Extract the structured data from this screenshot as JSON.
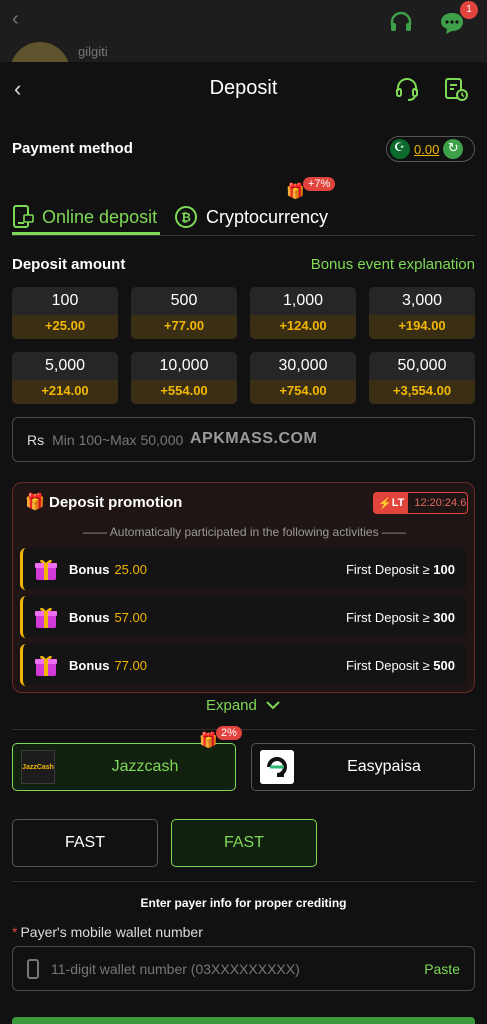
{
  "background_app": {
    "back_icon": "back-chevron-icon",
    "username": "gilgiti",
    "notification_count": "1"
  },
  "header": {
    "title": "Deposit",
    "support_icon": "headset-icon",
    "history_icon": "history-icon"
  },
  "payment_method": {
    "label": "Payment method",
    "balance": "0.00"
  },
  "tabs": [
    {
      "label": "Online deposit",
      "active": true
    },
    {
      "label": "Cryptocurrency",
      "active": false,
      "badge": "+7%"
    }
  ],
  "deposit_amount": {
    "label": "Deposit amount",
    "bonus_link": "Bonus event explanation",
    "options": [
      {
        "amount": "100",
        "bonus": "+25.00"
      },
      {
        "amount": "500",
        "bonus": "+77.00"
      },
      {
        "amount": "1,000",
        "bonus": "+124.00"
      },
      {
        "amount": "3,000",
        "bonus": "+194.00"
      },
      {
        "amount": "5,000",
        "bonus": "+214.00"
      },
      {
        "amount": "10,000",
        "bonus": "+554.00"
      },
      {
        "amount": "30,000",
        "bonus": "+754.00"
      },
      {
        "amount": "50,000",
        "bonus": "+3,554.00"
      }
    ],
    "currency": "Rs",
    "placeholder": "Min 100~Max 50,000",
    "watermark": "APKMASS.COM"
  },
  "promotion": {
    "title": "Deposit promotion",
    "timer_tag": "LT",
    "timer": "12:20:24.6",
    "subtitle": "—— Automatically participated in the following activities ——",
    "rows": [
      {
        "bonus_label": "Bonus",
        "bonus_value": "25.00",
        "condition": "First Deposit ≥",
        "threshold": "100"
      },
      {
        "bonus_label": "Bonus",
        "bonus_value": "57.00",
        "condition": "First Deposit ≥",
        "threshold": "300"
      },
      {
        "bonus_label": "Bonus",
        "bonus_value": "77.00",
        "condition": "First Deposit ≥",
        "threshold": "500"
      }
    ],
    "expand_label": "Expand"
  },
  "channels": [
    {
      "name": "Jazzcash",
      "logo_text": "JazzCash",
      "badge": "2%",
      "selected": true
    },
    {
      "name": "Easypaisa",
      "selected": false
    }
  ],
  "speed_options": [
    {
      "label": "FAST",
      "selected": false
    },
    {
      "label": "FAST",
      "selected": true
    }
  ],
  "payer": {
    "note": "Enter payer info for proper crediting",
    "required_mark": "*",
    "wallet_label": "Payer's mobile wallet number",
    "wallet_placeholder": "11-digit wallet number (03XXXXXXXXX)",
    "paste_label": "Paste"
  },
  "colors": {
    "accent_green": "#7ed957",
    "bonus_gold": "#f2b705",
    "alert_red": "#e0443c",
    "background": "#111111"
  }
}
